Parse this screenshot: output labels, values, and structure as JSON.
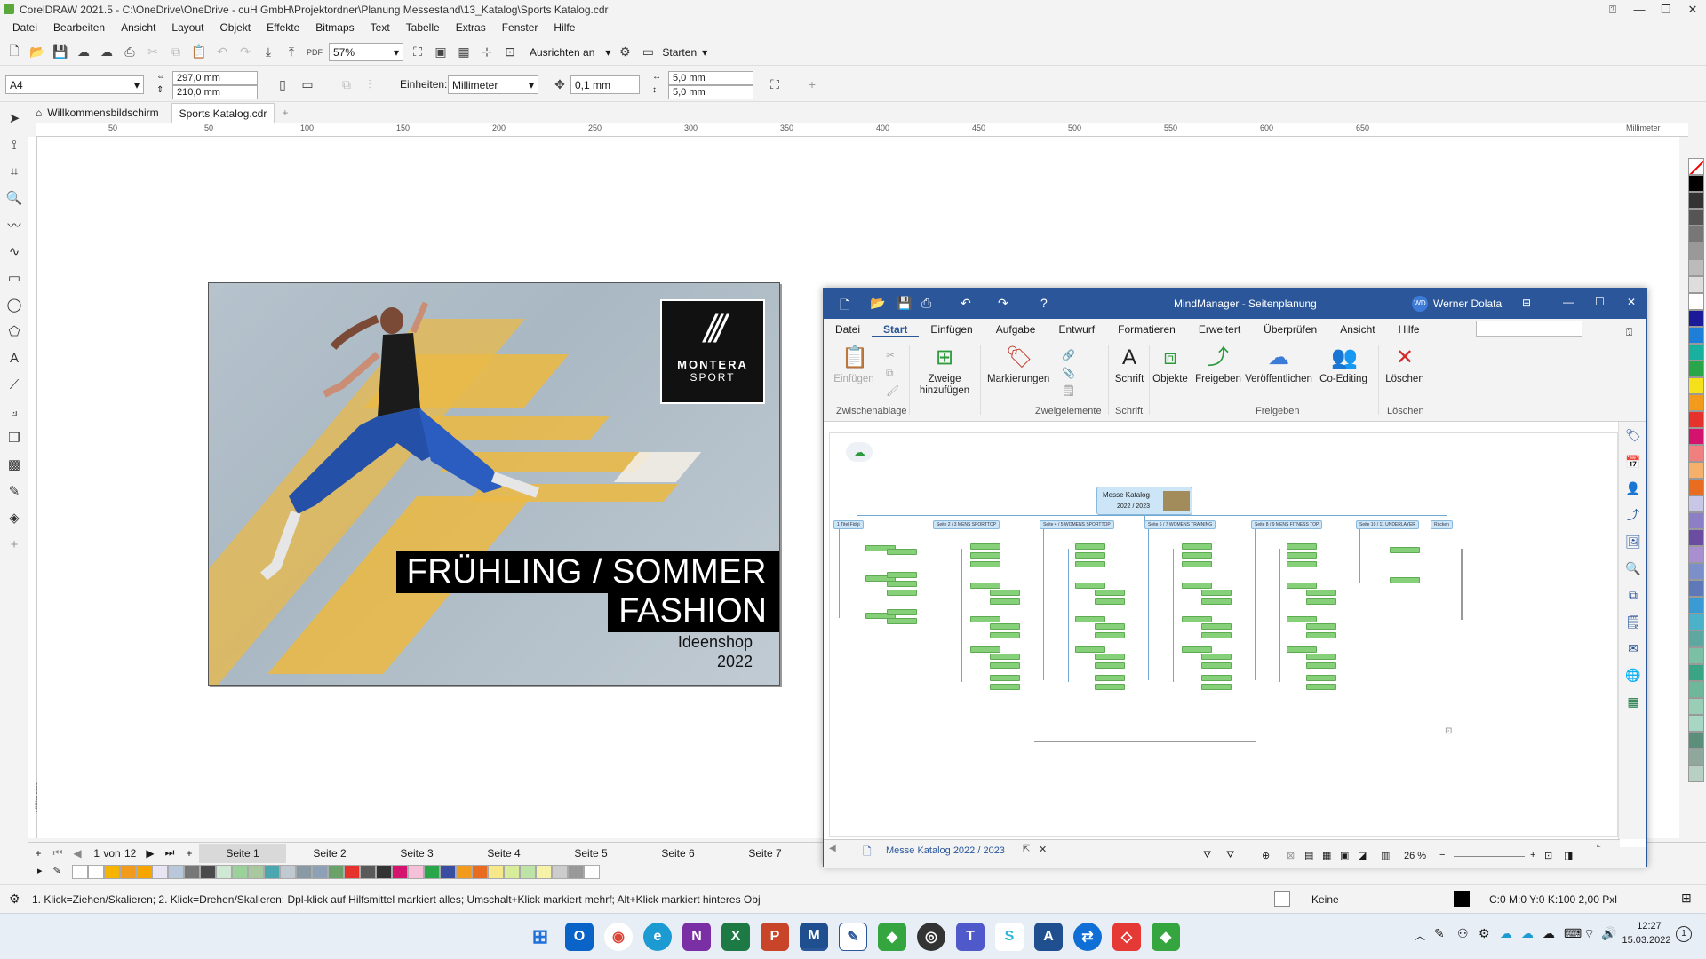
{
  "app": {
    "title": "CorelDRAW 2021.5 - C:\\OneDrive\\OneDrive - cuH GmbH\\Projektordner\\Planung Messestand\\13_Katalog\\Sports Katalog.cdr",
    "menu": [
      "Datei",
      "Bearbeiten",
      "Ansicht",
      "Layout",
      "Objekt",
      "Effekte",
      "Bitmaps",
      "Text",
      "Tabelle",
      "Extras",
      "Fenster",
      "Hilfe"
    ]
  },
  "toolbar": {
    "zoom": "57%",
    "snap_label": "Ausrichten an",
    "launch_label": "Starten"
  },
  "propbar": {
    "page_size": "A4",
    "width": "297,0 mm",
    "height": "210,0 mm",
    "units_label": "Einheiten:",
    "units_value": "Millimeter",
    "nudge": "0,1 mm",
    "dup_x": "5,0 mm",
    "dup_y": "5,0 mm"
  },
  "doctabs": {
    "welcome": "Willkommensbildschirm",
    "doc": "Sports Katalog.cdr",
    "add": "+"
  },
  "ruler": {
    "ticks": [
      "50",
      "0",
      "50",
      "100",
      "150",
      "200",
      "250",
      "300",
      "350",
      "400",
      "450",
      "500",
      "550",
      "600",
      "650"
    ],
    "unit": "Millimeter",
    "v_unit": "Millimeter"
  },
  "cover": {
    "brand_line1": "MONTERA",
    "brand_line2": "SPORT",
    "headline1": "FRÜHLING / SOMMER",
    "headline2": "FASHION",
    "shop": "Ideenshop",
    "year": "2022"
  },
  "pagenav": {
    "current": "1",
    "of": "von",
    "total": "12",
    "pages": [
      "Seite 1",
      "Seite 2",
      "Seite 3",
      "Seite 4",
      "Seite 5",
      "Seite 6",
      "Seite 7"
    ]
  },
  "status": {
    "hint": "1. Klick=Ziehen/Skalieren; 2. Klick=Drehen/Skalieren; Dpl-klick auf Hilfsmittel markiert alles; Umschalt+Klick markiert mehrf; Alt+Klick markiert hinteres Obj",
    "fill": "Keine",
    "outline": "C:0 M:0 Y:0 K:100  2,00 Pxl"
  },
  "clock": {
    "time": "12:27",
    "date": "15.03.2022"
  },
  "mindmanager": {
    "title": "MindManager - Seitenplanung",
    "user": "Werner Dolata",
    "user_initials": "WD",
    "tabs": [
      "Datei",
      "Start",
      "Einfügen",
      "Aufgabe",
      "Entwurf",
      "Formatieren",
      "Erweitert",
      "Überprüfen",
      "Ansicht",
      "Hilfe"
    ],
    "ribbon": {
      "paste": "Einfügen",
      "clipboard_group": "Zwischenablage",
      "add_branches": "Zweige hinzufügen",
      "markers": "Markierungen",
      "branch_elements_group": "Zweigelemente",
      "font": "Schrift",
      "font_group": "Schrift",
      "objects": "Objekte",
      "share": "Freigeben",
      "publish": "Veröffentlichen",
      "coediting": "Co-Editing",
      "share_group": "Freigeben",
      "delete": "Löschen",
      "delete_group": "Löschen"
    },
    "map": {
      "central_title": "Messe Katalog",
      "central_sub": "2022 / 2023",
      "branches": [
        "1 Titel Fidgi",
        "Seite 2 / 3 MENS SPORTTOP",
        "Seite 4 / 5 WOMENS SPORTTOP",
        "Seite 6 / 7 WOMENS TRAINING",
        "Seite 8 / 9 MENS FITNESS TOP",
        "Seite 10 / 11 UNDERLAYER",
        "Rücken"
      ]
    },
    "doc_tab": "Messe Katalog 2022 / 2023",
    "zoom": "26 %"
  }
}
